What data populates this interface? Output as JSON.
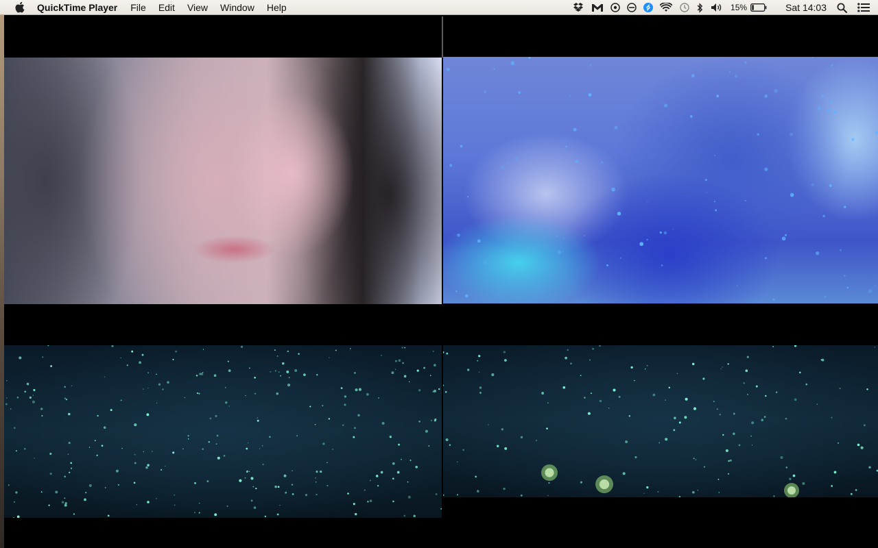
{
  "menubar": {
    "apple_icon": "apple-logo-icon",
    "app_name": "QuickTime Player",
    "menus": [
      "File",
      "Edit",
      "View",
      "Window",
      "Help"
    ],
    "status_icons": [
      "dropbox-icon",
      "gmail-notifier-icon",
      "menu-extra-icon",
      "do-not-disturb-icon",
      "shazam-icon",
      "wifi-icon",
      "time-machine-icon",
      "bluetooth-icon",
      "volume-icon"
    ],
    "battery_percent": "15%",
    "battery_level": 0.15,
    "clock": "Sat 14:03",
    "search_icon": "spotlight-search-icon",
    "notification_icon": "notification-center-icon"
  },
  "players": [
    {
      "content": "blurred close-up of a woman's face",
      "accent": "#c9a7b5"
    },
    {
      "content": "blue-tinted frame with glowing particles",
      "accent": "#5a74e0"
    },
    {
      "content": "dark teal frame with scattered luminous particles",
      "accent": "#7ef5d5"
    },
    {
      "content": "dark teal frame with scattered luminous particles and orbs",
      "accent": "#7ef5d5"
    }
  ],
  "colors": {
    "menubar_bg": "#ece8e3",
    "window_bg": "#000000"
  }
}
